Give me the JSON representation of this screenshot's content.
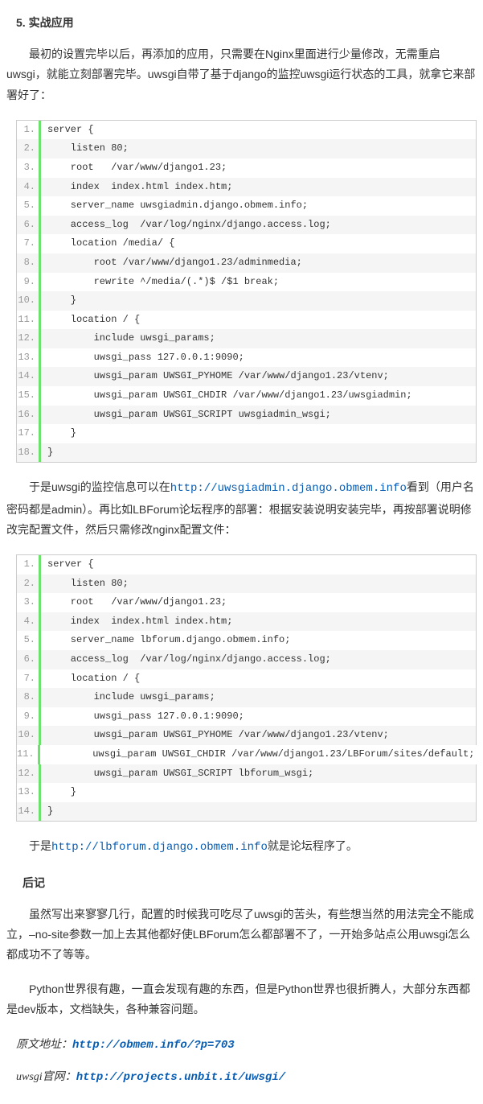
{
  "heading_section": "5. 实战应用",
  "para1_a": "最初的设置完毕以后，再添加的应用，只需要在Nginx里面进行少量修改，无需重启uwsgi，就能立刻部署完毕。uwsgi自带了基于django的监控uwsgi运行状态的工具，就拿它来部署好了：",
  "code1": [
    "server {",
    "    listen 80;",
    "    root   /var/www/django1.23;",
    "    index  index.html index.htm;",
    "    server_name uwsgiadmin.django.obmem.info;",
    "    access_log  /var/log/nginx/django.access.log;",
    "    location /media/ {",
    "        root /var/www/django1.23/adminmedia;",
    "        rewrite ^/media/(.*)$ /$1 break;",
    "    }",
    "    location / {",
    "        include uwsgi_params;",
    "        uwsgi_pass 127.0.0.1:9090;",
    "        uwsgi_param UWSGI_PYHOME /var/www/django1.23/vtenv;",
    "        uwsgi_param UWSGI_CHDIR /var/www/django1.23/uwsgiadmin;",
    "        uwsgi_param UWSGI_SCRIPT uwsgiadmin_wsgi;",
    "    }",
    "}"
  ],
  "para2_a": "于是uwsgi的监控信息可以在",
  "link1": "http://uwsgiadmin.django.obmem.info",
  "para2_b": "看到（用户名密码都是admin）。再比如LBForum论坛程序的部署：根据安装说明安装完毕，再按部署说明修改完配置文件，然后只需修改nginx配置文件：",
  "code2": [
    "server {",
    "    listen 80;",
    "    root   /var/www/django1.23;",
    "    index  index.html index.htm;",
    "    server_name lbforum.django.obmem.info;",
    "    access_log  /var/log/nginx/django.access.log;",
    "    location / {",
    "        include uwsgi_params;",
    "        uwsgi_pass 127.0.0.1:9090;",
    "        uwsgi_param UWSGI_PYHOME /var/www/django1.23/vtenv;",
    "        uwsgi_param UWSGI_CHDIR /var/www/django1.23/LBForum/sites/default;",
    "        uwsgi_param UWSGI_SCRIPT lbforum_wsgi;",
    "    }",
    "}"
  ],
  "para3_a": "于是",
  "link2": "http://lbforum.django.obmem.info",
  "para3_b": "就是论坛程序了。",
  "heading_postscript": "后记",
  "para4": "虽然写出来寥寥几行，配置的时候我可吃尽了uwsgi的苦头，有些想当然的用法完全不能成立，–no-site参数一加上去其他都好使LBForum怎么都部署不了，一开始多站点公用uwsgi怎么都成功不了等等。",
  "para5": "Python世界很有趣，一直会发现有趣的东西，但是Python世界也很折腾人，大部分东西都是dev版本，文档缺失，各种兼容问题。",
  "ref1_label": "原文地址：",
  "ref1_link": "http://obmem.info/?p=703",
  "ref2_label": "uwsgi官网：",
  "ref2_link": "http://projects.unbit.it/uwsgi/"
}
